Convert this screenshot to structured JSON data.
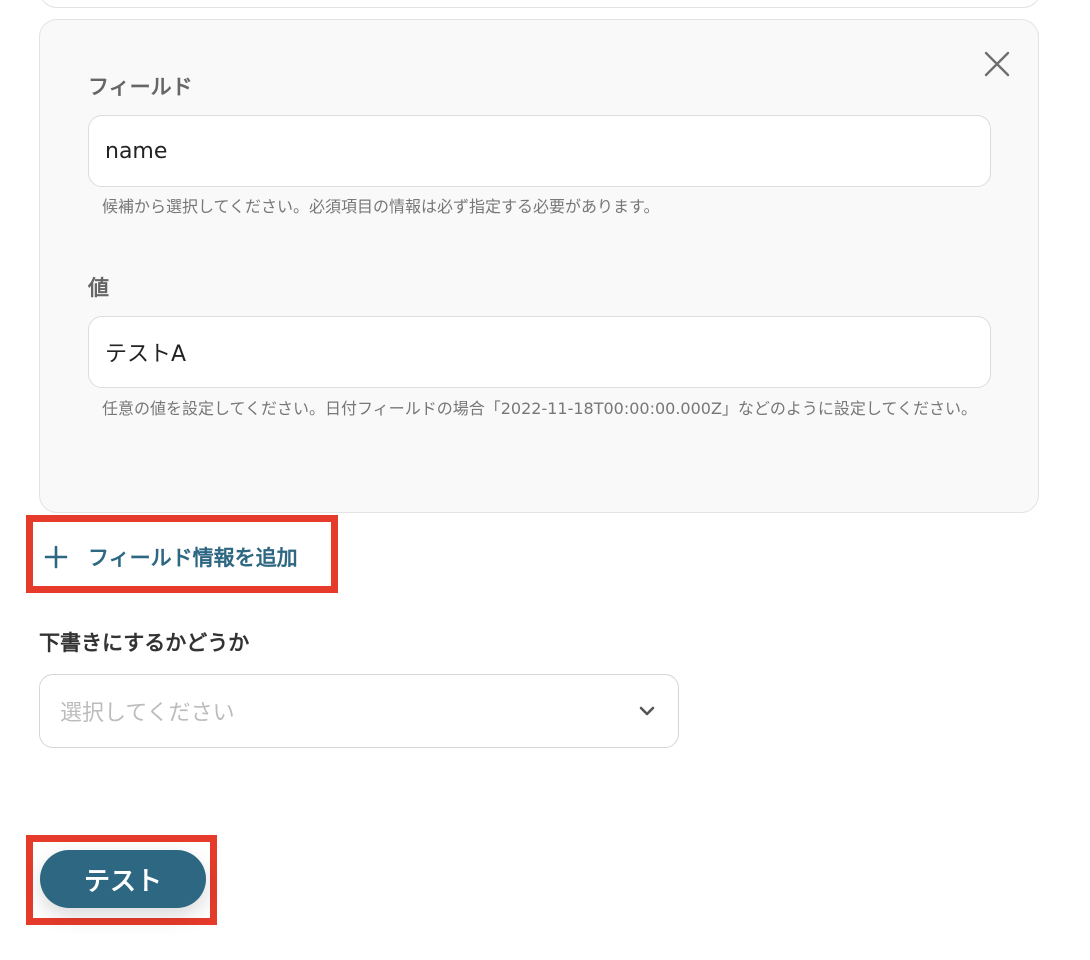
{
  "field_card": {
    "field_label": "フィールド",
    "field_value": "name",
    "field_help": "候補から選択してください。必須項目の情報は必ず指定する必要があります。",
    "value_label": "値",
    "value_value": "テストA",
    "value_help": "任意の値を設定してください。日付フィールドの場合「2022-11-18T00:00:00.000Z」などのように設定してください。"
  },
  "add_field": {
    "label": "フィールド情報を追加"
  },
  "draft": {
    "label": "下書きにするかどうか",
    "placeholder": "選択してください"
  },
  "test_button": {
    "label": "テスト"
  },
  "icons": {
    "close": "close-icon",
    "plus": "plus-icon",
    "chevron": "chevron-down-icon"
  },
  "colors": {
    "accent": "#2e6782",
    "highlight": "#e63b2a",
    "card_bg": "#f9f9f9"
  }
}
